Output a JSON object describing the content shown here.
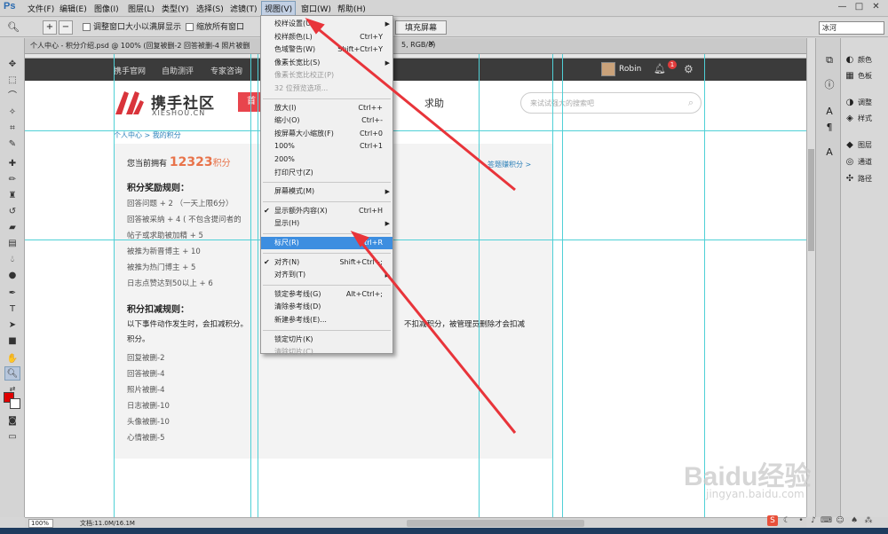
{
  "app": {
    "logo": "Ps"
  },
  "menubar": {
    "items": [
      "文件(F)",
      "编辑(E)",
      "图像(I)",
      "图层(L)",
      "类型(Y)",
      "选择(S)",
      "滤镜(T)",
      "视图(V)",
      "窗口(W)",
      "帮助(H)"
    ],
    "active": "视图(V)",
    "window_controls": [
      "—",
      "□",
      "✕"
    ]
  },
  "options_bar": {
    "resize_window": "调整窗口大小以满屏显示",
    "zoom_all": "缩放所有窗口",
    "fill_screen": "填充屏幕",
    "workspace": "冰河"
  },
  "document": {
    "tab_title": "个人中心 - 积分介绍.psd @ 100% (回复被删-2 回答被删-4 照片被删",
    "tab_suffix": "5, RGB/8)"
  },
  "site": {
    "nav": [
      "携手官网",
      "自助测评",
      "专家咨询"
    ],
    "user": "Robin",
    "notif_count": "1",
    "logo_cn": "携手社区",
    "logo_en": "XIESHOU.CN",
    "nav_home": "首",
    "nav_help": "求助",
    "search_placeholder": "来试试强大的搜索吧",
    "breadcrumb": "个人中心 > 我的积分",
    "points_prefix": "您当前拥有",
    "points_value": "12323",
    "points_unit": "积分",
    "earn_link": "答题赚积分 >",
    "reward_title": "积分奖励规则：",
    "reward_rules": [
      "回答问题 + 2 （一天上限6分）",
      "回答被采纳 + 4 ( 不包含提问者的",
      "帖子或求助被加精 + 5",
      "被推为新晋博主 + 10",
      "被推为热门博主 + 5",
      "日志点赞达到50以上 + 6"
    ],
    "deduct_title": "积分扣减规则：",
    "deduct_intro_1": "以下事件动作发生时，会扣减积分。",
    "deduct_intro_right": "不扣减积分，被管理员删除才会扣减",
    "deduct_intro_2": "积分。",
    "deduct_rules": [
      "回复被删-2",
      "回答被删-4",
      "照片被删-4",
      "日志被删-10",
      "头像被删-10",
      "心情被删-5"
    ]
  },
  "view_menu": [
    {
      "label": "校样设置(U)",
      "shortcut": "",
      "submenu": true
    },
    {
      "label": "校样颜色(L)",
      "shortcut": "Ctrl+Y"
    },
    {
      "label": "色域警告(W)",
      "shortcut": "Shift+Ctrl+Y"
    },
    {
      "label": "像素长宽比(S)",
      "shortcut": "",
      "submenu": true
    },
    {
      "label": "像素长宽比校正(P)",
      "shortcut": "",
      "disabled": true
    },
    {
      "label": "32 位预览选项...",
      "shortcut": "",
      "disabled": true
    },
    {
      "sep": true
    },
    {
      "label": "放大(I)",
      "shortcut": "Ctrl++"
    },
    {
      "label": "缩小(O)",
      "shortcut": "Ctrl+-"
    },
    {
      "label": "按屏幕大小缩放(F)",
      "shortcut": "Ctrl+0"
    },
    {
      "label": "100%",
      "shortcut": "Ctrl+1"
    },
    {
      "label": "200%",
      "shortcut": ""
    },
    {
      "label": "打印尺寸(Z)",
      "shortcut": ""
    },
    {
      "sep": true
    },
    {
      "label": "屏幕模式(M)",
      "shortcut": "",
      "submenu": true
    },
    {
      "sep": true
    },
    {
      "label": "显示额外内容(X)",
      "shortcut": "Ctrl+H",
      "checked": true
    },
    {
      "label": "显示(H)",
      "shortcut": "",
      "submenu": true
    },
    {
      "sep": true
    },
    {
      "label": "标尺(R)",
      "shortcut": "Ctrl+R",
      "highlighted": true
    },
    {
      "sep": true
    },
    {
      "label": "对齐(N)",
      "shortcut": "Shift+Ctrl+;",
      "checked": true
    },
    {
      "label": "对齐到(T)",
      "shortcut": "",
      "submenu": true
    },
    {
      "sep": true
    },
    {
      "label": "锁定参考线(G)",
      "shortcut": "Alt+Ctrl+;"
    },
    {
      "label": "清除参考线(D)",
      "shortcut": ""
    },
    {
      "label": "新建参考线(E)...",
      "shortcut": ""
    },
    {
      "sep": true
    },
    {
      "label": "锁定切片(K)",
      "shortcut": ""
    },
    {
      "label": "清除切片(C)",
      "shortcut": "",
      "disabled": true
    }
  ],
  "status_bar": {
    "zoom": "100%",
    "doc_size": "文档:11.0M/16.1M"
  },
  "panels": {
    "group1": [
      "颜色",
      "色板"
    ],
    "group2": [
      "调整",
      "样式"
    ],
    "group3": [
      "图层",
      "通道",
      "路径"
    ]
  },
  "watermark": {
    "main": "Baidu经验",
    "sub": "jingyan.baidu.com"
  },
  "colors": {
    "accent_red": "#e8454d",
    "guide": "#4fd0d6",
    "highlight": "#3d8ee0",
    "points_orange": "#e8734a",
    "arrow": "#e8343a"
  }
}
